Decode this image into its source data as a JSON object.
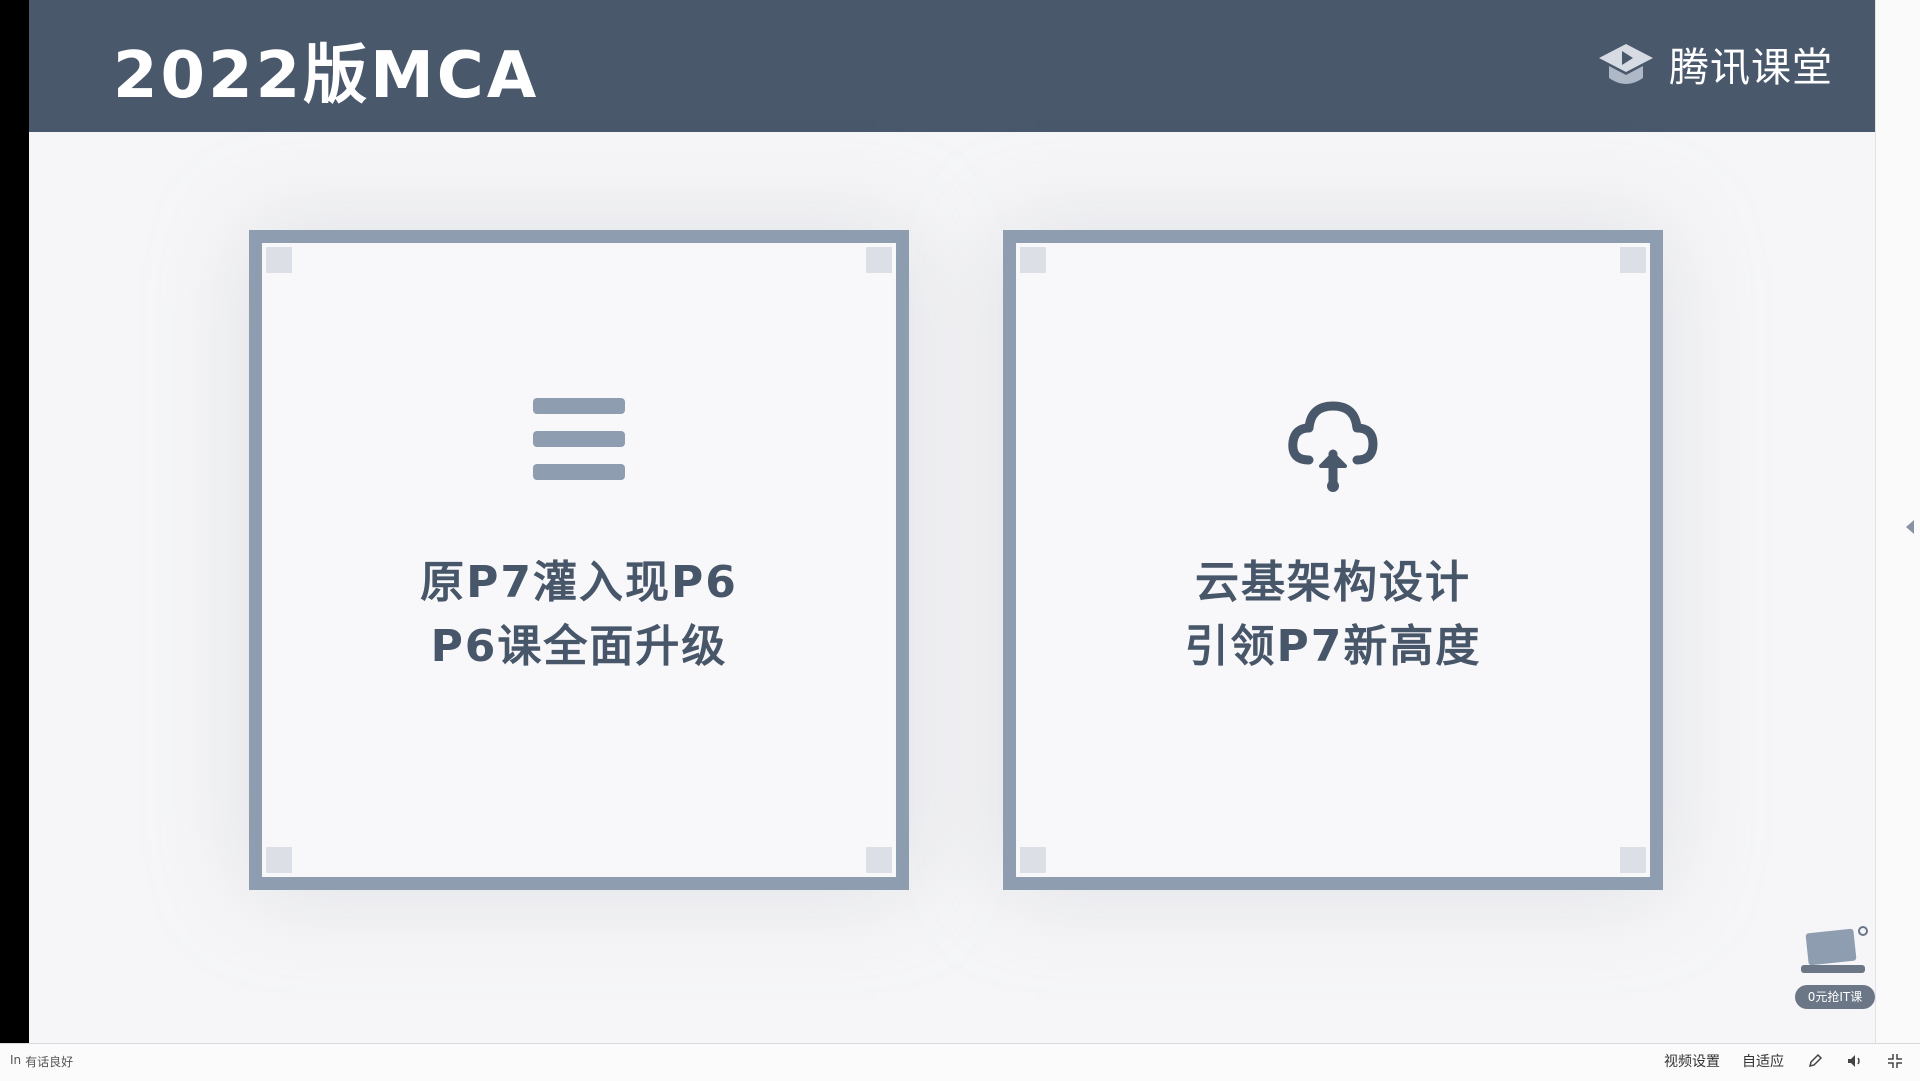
{
  "slide": {
    "title": "2022版MCA",
    "brand_name": "腾讯课堂",
    "brand_icon": "tencent-classroom-logo-icon",
    "cards": [
      {
        "icon": "menu-bars-icon",
        "line1": "原P7灌入现P6",
        "line2": "P6课全面升级"
      },
      {
        "icon": "cloud-upload-icon",
        "line1": "云基架构设计",
        "line2": "引领P7新高度"
      }
    ],
    "colors": {
      "header": "#4a586c",
      "card_border": "#8e9db0",
      "text": "#48566a",
      "background": "#f6f6f8"
    }
  },
  "promo": {
    "label": "0元抢IT课",
    "icon": "laptop-icon"
  },
  "player_bar": {
    "left_text": "In",
    "left_caption": "有话良好",
    "video_settings": "视频设置",
    "fit_mode": "自适应",
    "icons": [
      "pen-icon",
      "volume-icon",
      "fullscreen-exit-icon"
    ]
  }
}
